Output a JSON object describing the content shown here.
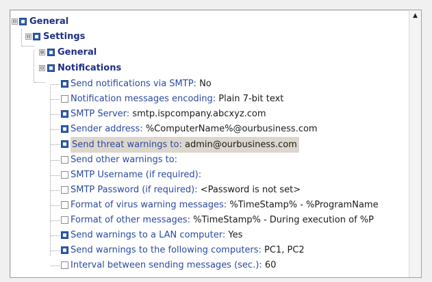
{
  "tree": {
    "root": {
      "label": "General",
      "toggle": "⊟"
    },
    "settings": {
      "label": "Settings",
      "toggle": "⊟"
    },
    "general": {
      "label": "General",
      "toggle": "⊞"
    },
    "notifications": {
      "label": "Notifications",
      "toggle": "⊟"
    },
    "items": [
      {
        "label": "Send notifications via SMTP",
        "value": "No",
        "checked": true
      },
      {
        "label": "Notification messages encoding",
        "value": "Plain 7-bit text",
        "checked": false
      },
      {
        "label": "SMTP Server",
        "value": "smtp.ispcompany.abcxyz.com",
        "checked": true
      },
      {
        "label": "Sender address",
        "value": "%ComputerName%@ourbusiness.com",
        "checked": true
      },
      {
        "label": "Send threat warnings to",
        "value": "admin@ourbusiness.com",
        "checked": true,
        "selected": true
      },
      {
        "label": "Send other warnings to",
        "value": "",
        "checked": false
      },
      {
        "label": "SMTP Username (if required)",
        "value": "",
        "checked": false
      },
      {
        "label": "SMTP Password (if required)",
        "value": "<Password is not set>",
        "checked": false
      },
      {
        "label": "Format of virus warning messages",
        "value": "%TimeStamp% - %ProgramName",
        "checked": false
      },
      {
        "label": "Format of other messages",
        "value": "%TimeStamp% - During execution of %P",
        "checked": false
      },
      {
        "label": "Send warnings to a LAN computer",
        "value": "Yes",
        "checked": true
      },
      {
        "label": "Send warnings to the following computers",
        "value": "PC1, PC2",
        "checked": true
      },
      {
        "label": "Interval between sending messages (sec.)",
        "value": "60",
        "checked": false
      }
    ]
  },
  "scrollbar": {
    "up_arrow": "▲"
  },
  "colors": {
    "selected_row": "#ddd6cc",
    "label_blue": "#2b4aa0",
    "checkbox_on": "#2f5fb0"
  }
}
